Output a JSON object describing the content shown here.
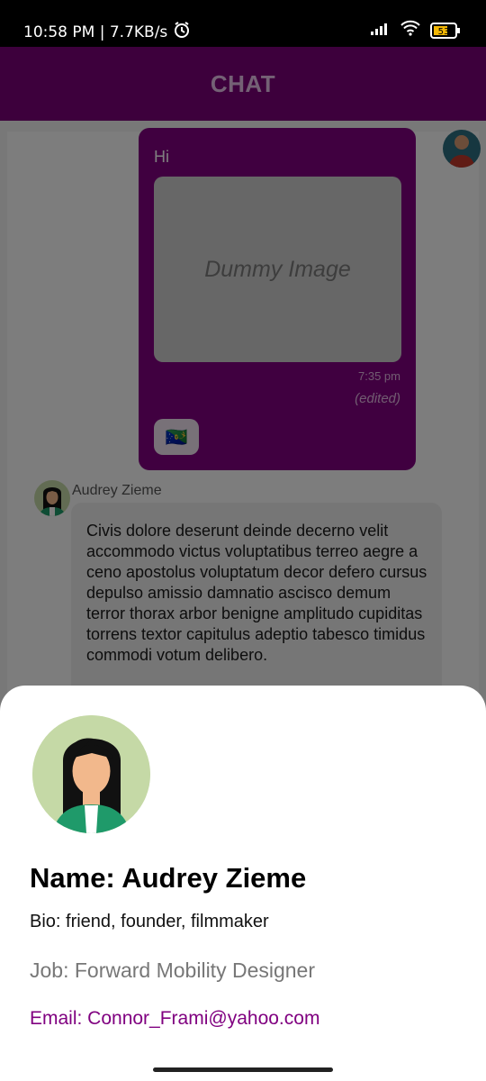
{
  "status_bar": {
    "time_speed": "10:58 PM | 7.7KB/s",
    "battery": "53",
    "icons": [
      "alarm-icon",
      "signal-icon",
      "wifi-icon",
      "battery-icon"
    ]
  },
  "app_bar": {
    "title": "CHAT"
  },
  "chat": {
    "sent_message": {
      "text": "Hi",
      "image_placeholder": "Dummy Image",
      "time": "7:35 pm",
      "edited_label": "(edited)",
      "reaction": "🇨🇽"
    },
    "received_message": {
      "author": "Audrey Zieme",
      "text": "Civis dolore deserunt deinde decerno velit accommodo victus voluptatibus terreo aegre a ceno apostolus voluptatum decor defero cursus depulso amissio damnatio ascisco demum terror thorax arbor benigne amplitudo cupiditas torrens textor capitulus adeptio tabesco timidus commodi votum delibero."
    }
  },
  "profile_sheet": {
    "name_line": "Name: Audrey Zieme",
    "bio_line": "Bio: friend, founder, filmmaker",
    "job_line": "Job: Forward Mobility Designer",
    "email_line": "Email: Connor_Frami@yahoo.com"
  },
  "colors": {
    "brand": "#7b0079",
    "bubble": "#800080",
    "email": "#800080"
  }
}
